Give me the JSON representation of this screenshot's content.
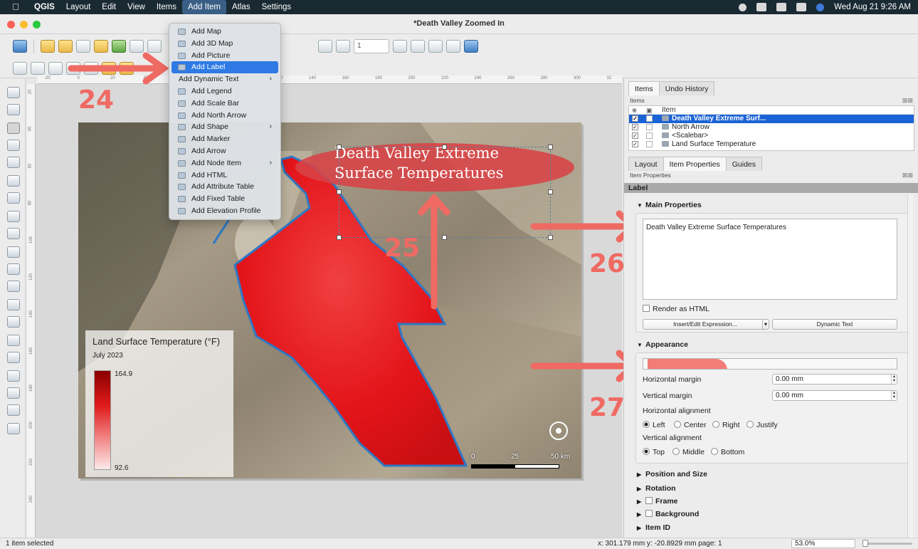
{
  "menubar": {
    "items": [
      "QGIS",
      "Layout",
      "Edit",
      "View",
      "Items",
      "Add Item",
      "Atlas",
      "Settings"
    ],
    "datetime": "Wed Aug 21  9:26 AM"
  },
  "window": {
    "title": "*Death Valley Zoomed In"
  },
  "toolbar": {
    "page_input": "1"
  },
  "add_menu": {
    "items": [
      {
        "label": "Add Map",
        "icon": "map-icon",
        "submenu": false
      },
      {
        "label": "Add 3D Map",
        "icon": "3d-map-icon",
        "submenu": false
      },
      {
        "label": "Add Picture",
        "icon": "picture-icon",
        "submenu": false
      },
      {
        "label": "Add Label",
        "icon": "label-icon",
        "submenu": false,
        "highlighted": true
      },
      {
        "label": "Add Dynamic Text",
        "icon": "",
        "submenu": true
      },
      {
        "label": "Add Legend",
        "icon": "legend-icon",
        "submenu": false
      },
      {
        "label": "Add Scale Bar",
        "icon": "scale-bar-icon",
        "submenu": false
      },
      {
        "label": "Add North Arrow",
        "icon": "north-arrow-icon",
        "submenu": false
      },
      {
        "label": "Add Shape",
        "icon": "shape-icon",
        "submenu": true
      },
      {
        "label": "Add Marker",
        "icon": "marker-icon",
        "submenu": false
      },
      {
        "label": "Add Arrow",
        "icon": "arrow-icon",
        "submenu": false
      },
      {
        "label": "Add Node Item",
        "icon": "node-item-icon",
        "submenu": true
      },
      {
        "label": "Add HTML",
        "icon": "html-icon",
        "submenu": false
      },
      {
        "label": "Add Attribute Table",
        "icon": "attribute-table-icon",
        "submenu": false
      },
      {
        "label": "Add Fixed Table",
        "icon": "fixed-table-icon",
        "submenu": false
      },
      {
        "label": "Add Elevation Profile",
        "icon": "elevation-profile-icon",
        "submenu": false
      }
    ]
  },
  "ruler_top": [
    "-20",
    "0",
    "20",
    "40",
    "60",
    "80",
    "100",
    "120",
    "140",
    "160",
    "180",
    "200",
    "220",
    "240",
    "260",
    "280",
    "300",
    "32"
  ],
  "ruler_left": [
    "20",
    "40",
    "60",
    "80",
    "100",
    "120",
    "140",
    "160",
    "180",
    "200",
    "220",
    "240"
  ],
  "layout": {
    "label_text_line1": "Death Valley Extreme",
    "label_text_line2": "Surface Temperatures",
    "legend": {
      "title": "Land Surface Temperature (°F)",
      "subtitle": "July 2023",
      "max": "164.9",
      "min": "92.6"
    },
    "scalebar": {
      "l0": "0",
      "l1": "25",
      "l2": "50 km"
    }
  },
  "annotations": [
    "24",
    "25",
    "26",
    "27"
  ],
  "dock": {
    "top_tabs": [
      "Items",
      "Undo History"
    ],
    "items_panel_title": "Items",
    "items_header": "Item",
    "items": [
      {
        "label": "Death Valley Extreme Surf...",
        "checked": true,
        "selected": true
      },
      {
        "label": "North Arrow",
        "checked": true,
        "selected": false
      },
      {
        "label": "<Scalebar>",
        "checked": true,
        "selected": false
      },
      {
        "label": "Land Surface Temperature",
        "checked": true,
        "selected": false
      }
    ],
    "bottom_tabs": [
      "Layout",
      "Item Properties",
      "Guides"
    ],
    "props_panel_title": "Item Properties",
    "type_label": "Label",
    "main_props": {
      "title": "Main Properties",
      "text": "Death Valley Extreme Surface Temperatures",
      "render_html": "Render as HTML",
      "insert_btn": "Insert/Edit Expression...",
      "dynamic_btn": "Dynamic Text"
    },
    "appearance": {
      "title": "Appearance",
      "hmargin_label": "Horizontal margin",
      "hmargin": "0.00 mm",
      "vmargin_label": "Vertical margin",
      "vmargin": "0.00 mm",
      "halign_label": "Horizontal alignment",
      "halign_opts": [
        "Left",
        "Center",
        "Right",
        "Justify"
      ],
      "valign_label": "Vertical alignment",
      "valign_opts": [
        "Top",
        "Middle",
        "Bottom"
      ]
    },
    "collapsed": [
      "Position and Size",
      "Rotation",
      "Frame",
      "Background",
      "Item ID"
    ]
  },
  "status": {
    "selection": "1 item selected",
    "coords": "x: 301.179 mm    y: -20.8929 mm  page: 1",
    "zoom": "53.0%"
  },
  "colors": {
    "accent": "#2f7ae5",
    "annotation": "#ef6a63",
    "heat": "#e8141a"
  }
}
